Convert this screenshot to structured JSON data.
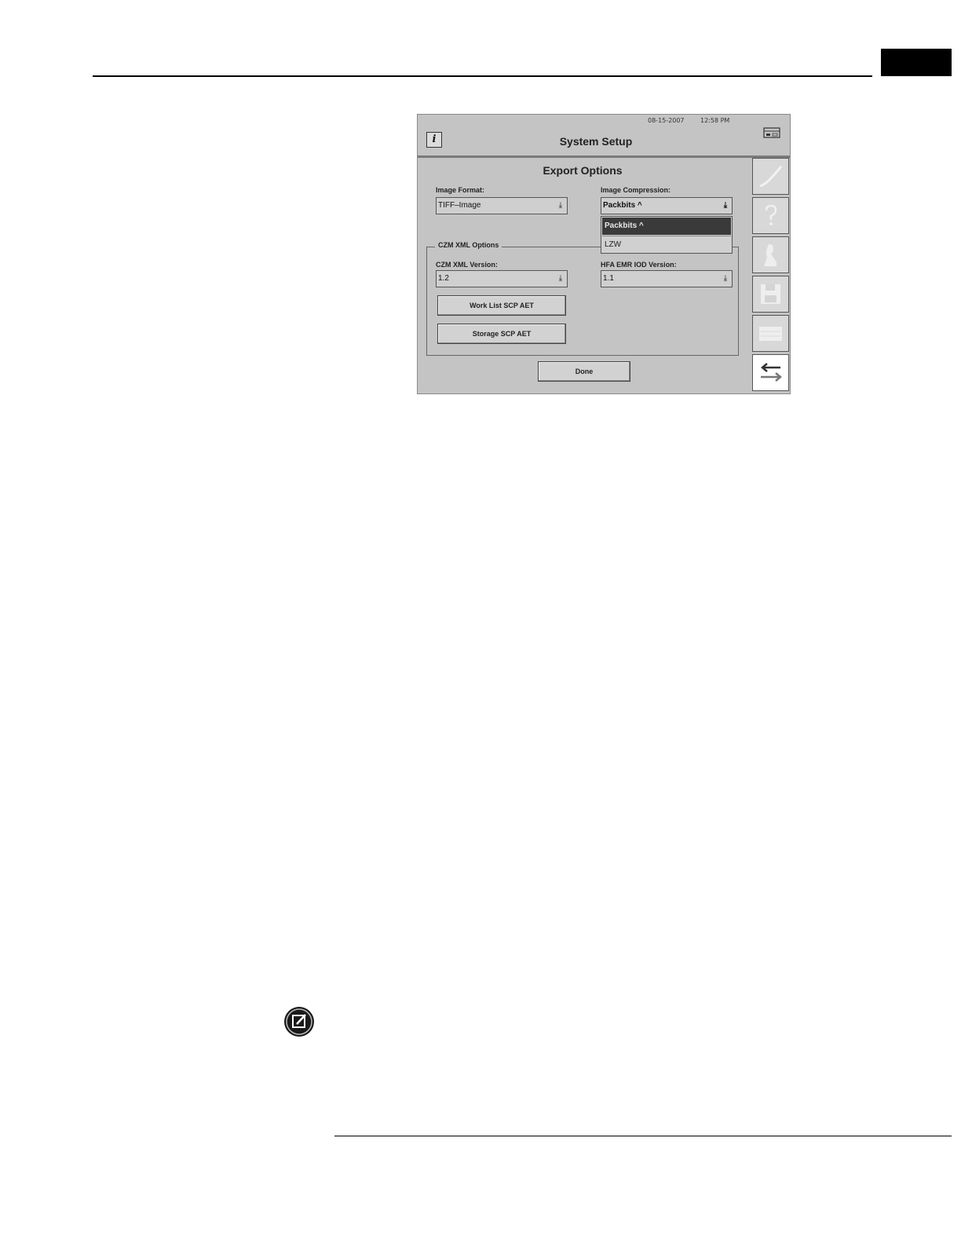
{
  "screen": {
    "date": "08-15-2007",
    "time": "12:58 PM",
    "title": "System Setup",
    "info_button": "i",
    "section_title": "Export Options",
    "image_format": {
      "label": "Image Format:",
      "value": "TIFF–Image"
    },
    "image_compression": {
      "label": "Image Compression:",
      "value": "Packbits ^",
      "options": [
        "Packbits ^",
        "LZW"
      ]
    },
    "czm_xml_options": {
      "legend": "CZM XML Options",
      "czm_xml_version": {
        "label": "CZM XML Version:",
        "value": "1.2"
      },
      "hfa_emr_iod_version": {
        "label": "HFA EMR IOD Version:",
        "value": "1.1"
      },
      "work_list_button": "Work List SCP AET",
      "storage_button": "Storage SCP AET"
    },
    "done_button": "Done",
    "sidebar_icons": [
      "curve-icon",
      "help-icon",
      "person-icon",
      "save-icon",
      "list-icon",
      "return-icon"
    ]
  },
  "icons": {
    "printer": "printer-icon",
    "note": "note-icon"
  }
}
